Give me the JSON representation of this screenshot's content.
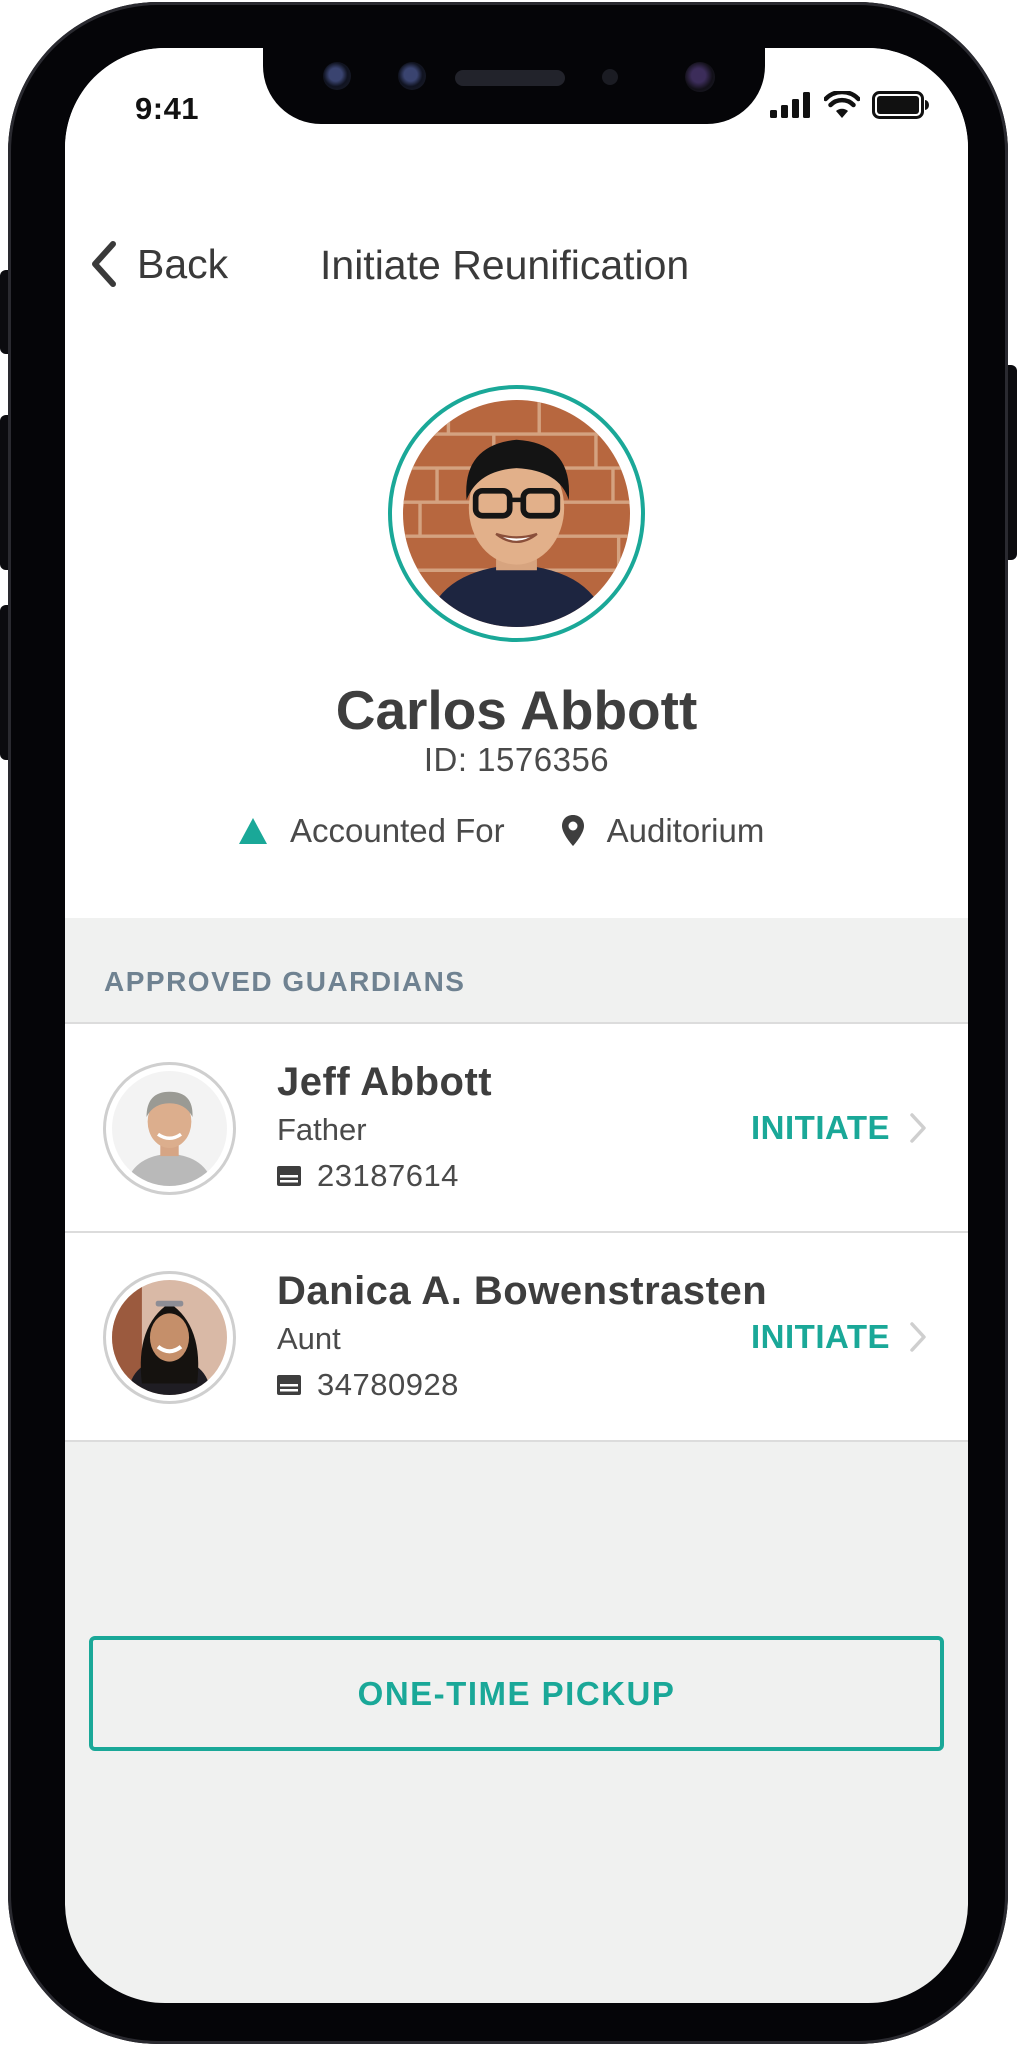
{
  "status_bar": {
    "time": "9:41"
  },
  "nav": {
    "back_label": "Back",
    "title": "Initiate Reunification"
  },
  "student": {
    "name": "Carlos Abbott",
    "id_text": "ID: 1576356",
    "status": "Accounted For",
    "location": "Auditorium"
  },
  "guardians_section": {
    "header": "APPROVED GUARDIANS",
    "items": [
      {
        "name": "Jeff Abbott",
        "relation": "Father",
        "id_number": "23187614",
        "action": "INITIATE"
      },
      {
        "name": "Danica A. Bowenstrasten",
        "relation": "Aunt",
        "id_number": "34780928",
        "action": "INITIATE"
      }
    ]
  },
  "pickup_button": {
    "label": "ONE-TIME PICKUP"
  },
  "icons": {
    "status_accounted": "triangle-icon",
    "location": "map-pin-icon",
    "id_card": "id-card-icon",
    "row_chevron": "chevron-right-icon",
    "back": "chevron-left-icon",
    "cellular": "cellular-signal-icon",
    "wifi": "wifi-icon",
    "battery": "battery-icon"
  },
  "colors": {
    "accent": "#1aa898",
    "section_header": "#6f8291",
    "background": "#f0f1f0"
  }
}
